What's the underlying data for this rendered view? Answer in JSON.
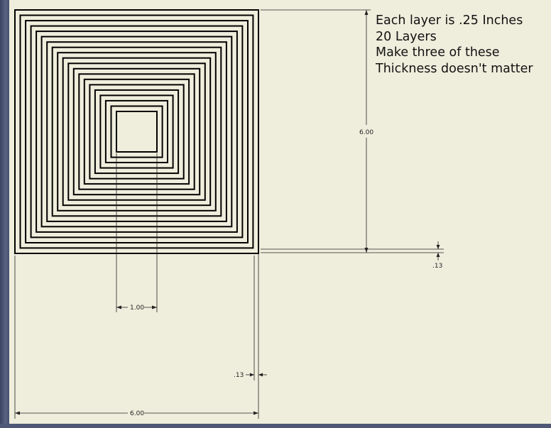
{
  "notes": {
    "line1": "Each layer is .25 Inches",
    "line2": "20 Layers",
    "line3": "Make three of these",
    "line4": "Thickness doesn't matter"
  },
  "dimensions": {
    "height": "6.00",
    "width": "6.00",
    "inner_width": "1.00",
    "margin_bottom": ".13",
    "margin_right": ".13"
  },
  "drawing": {
    "square_count": 20,
    "line_color": "#000000",
    "paper_color": "#efeedd"
  }
}
